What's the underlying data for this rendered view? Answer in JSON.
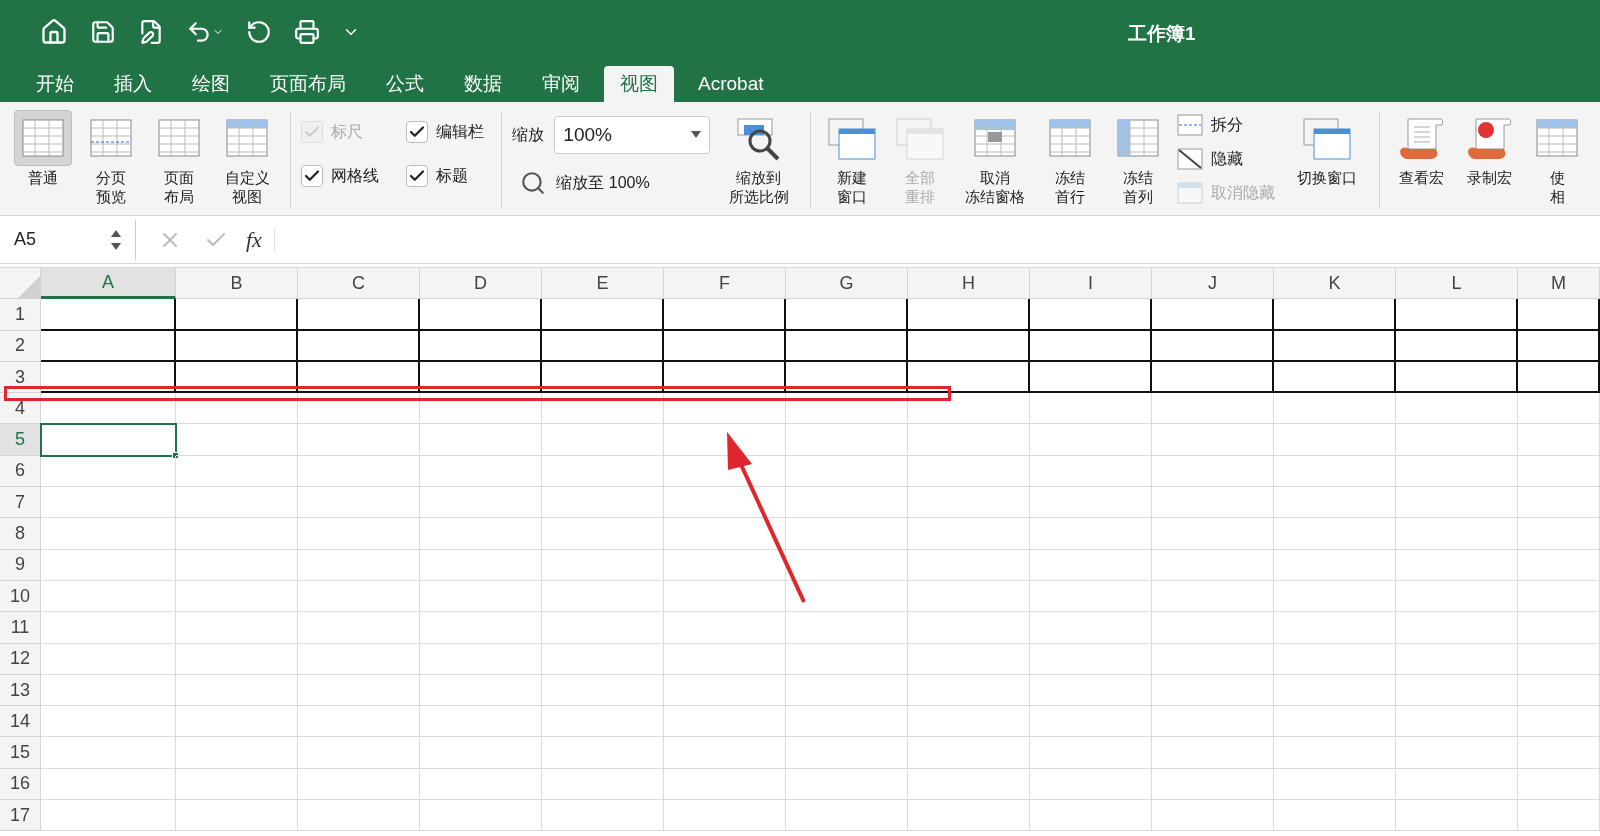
{
  "window": {
    "title": "工作簿1"
  },
  "tabs": [
    {
      "label": "开始",
      "selected": false
    },
    {
      "label": "插入",
      "selected": false
    },
    {
      "label": "绘图",
      "selected": false
    },
    {
      "label": "页面布局",
      "selected": false
    },
    {
      "label": "公式",
      "selected": false
    },
    {
      "label": "数据",
      "selected": false
    },
    {
      "label": "审阅",
      "selected": false
    },
    {
      "label": "视图",
      "selected": true
    },
    {
      "label": "Acrobat",
      "selected": false
    }
  ],
  "ribbon": {
    "views": [
      {
        "lines": [
          "普通"
        ],
        "selected": true
      },
      {
        "lines": [
          "分页",
          "预览"
        ],
        "selected": false
      },
      {
        "lines": [
          "页面",
          "布局"
        ],
        "selected": false
      },
      {
        "lines": [
          "自定义",
          "视图"
        ],
        "selected": false
      }
    ],
    "show": [
      {
        "label": "标尺",
        "checked": true,
        "disabled": true
      },
      {
        "label": "编辑栏",
        "checked": true,
        "disabled": false
      },
      {
        "label": "网格线",
        "checked": true,
        "disabled": false
      },
      {
        "label": "标题",
        "checked": true,
        "disabled": false
      }
    ],
    "zoom": {
      "label": "缩放",
      "value": "100%",
      "reset": "缩放至 100%",
      "selection": [
        "缩放到",
        "所选比例"
      ]
    },
    "window_buttons": [
      {
        "lines": [
          "新建",
          "窗口"
        ],
        "disabled": false
      },
      {
        "lines": [
          "全部",
          "重排"
        ],
        "disabled": true
      },
      {
        "lines": [
          "取消",
          "冻结窗格"
        ],
        "disabled": false
      },
      {
        "lines": [
          "冻结",
          "首行"
        ],
        "disabled": false
      },
      {
        "lines": [
          "冻结",
          "首列"
        ],
        "disabled": false
      }
    ],
    "pane_buttons": [
      {
        "label": "拆分",
        "disabled": false
      },
      {
        "label": "隐藏",
        "disabled": false
      },
      {
        "label": "取消隐藏",
        "disabled": true
      }
    ],
    "switch_window": "切换窗口",
    "macros": [
      {
        "lines": [
          "查看宏"
        ]
      },
      {
        "lines": [
          "录制宏"
        ]
      },
      {
        "lines": [
          "使",
          "相"
        ]
      }
    ]
  },
  "formula_bar": {
    "name_box": "A5",
    "fx": "fx"
  },
  "sheet": {
    "columns": [
      {
        "label": "A",
        "selected": true
      },
      {
        "label": "B",
        "selected": false
      },
      {
        "label": "C",
        "selected": false
      },
      {
        "label": "D",
        "selected": false
      },
      {
        "label": "E",
        "selected": false
      },
      {
        "label": "F",
        "selected": false
      },
      {
        "label": "G",
        "selected": false
      },
      {
        "label": "H",
        "selected": false
      },
      {
        "label": "I",
        "selected": false
      },
      {
        "label": "J",
        "selected": false
      },
      {
        "label": "K",
        "selected": false
      },
      {
        "label": "L",
        "selected": false
      },
      {
        "label": "M",
        "selected": false
      }
    ],
    "rows": [
      {
        "label": "1",
        "selected": false,
        "bordered": true
      },
      {
        "label": "2",
        "selected": false,
        "bordered": true
      },
      {
        "label": "3",
        "selected": false,
        "bordered": true
      },
      {
        "label": "4",
        "selected": false,
        "bordered": false
      },
      {
        "label": "5",
        "selected": true,
        "bordered": false
      },
      {
        "label": "6",
        "selected": false,
        "bordered": false
      },
      {
        "label": "7",
        "selected": false,
        "bordered": false
      },
      {
        "label": "8",
        "selected": false,
        "bordered": false
      },
      {
        "label": "9",
        "selected": false,
        "bordered": false
      },
      {
        "label": "10",
        "selected": false,
        "bordered": false
      },
      {
        "label": "11",
        "selected": false,
        "bordered": false
      },
      {
        "label": "12",
        "selected": false,
        "bordered": false
      },
      {
        "label": "13",
        "selected": false,
        "bordered": false
      },
      {
        "label": "14",
        "selected": false,
        "bordered": false
      },
      {
        "label": "15",
        "selected": false,
        "bordered": false
      },
      {
        "label": "16",
        "selected": false,
        "bordered": false
      },
      {
        "label": "17",
        "selected": false,
        "bordered": false
      }
    ]
  }
}
